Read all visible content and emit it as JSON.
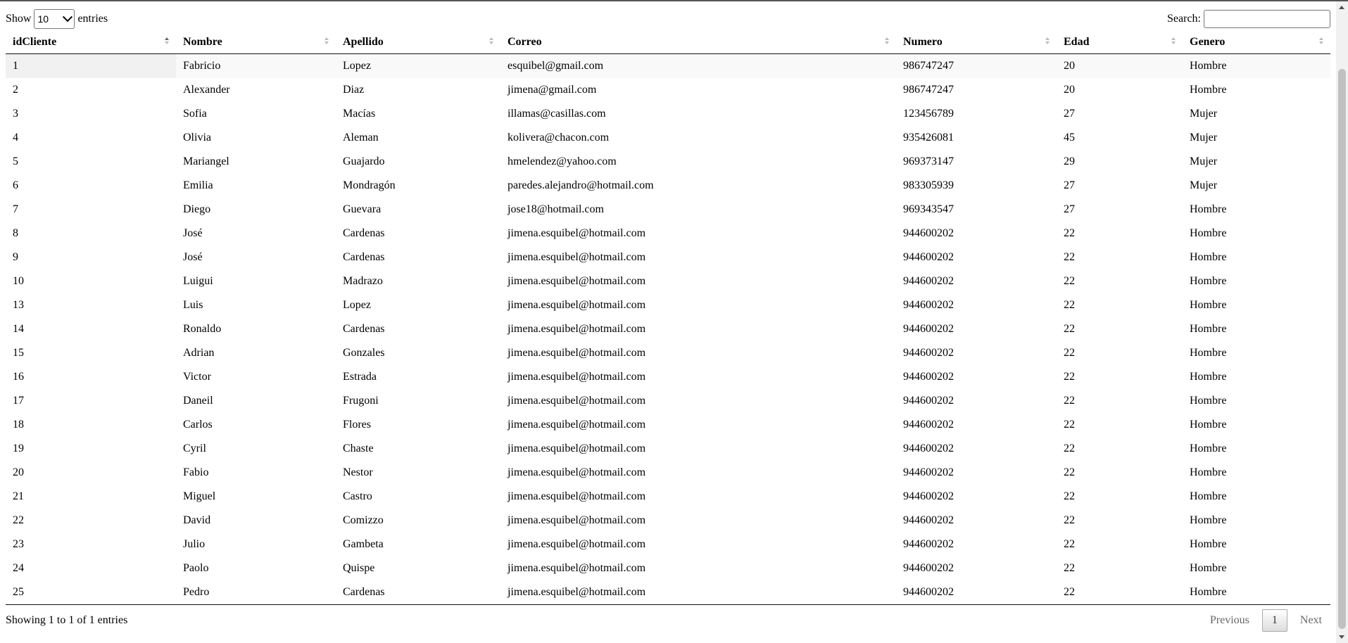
{
  "controls": {
    "show_label": "Show",
    "entries_label": "entries",
    "page_length": "10",
    "search_label": "Search:",
    "search_value": ""
  },
  "table": {
    "columns": [
      "idCliente",
      "Nombre",
      "Apellido",
      "Correo",
      "Numero",
      "Edad",
      "Genero"
    ],
    "rows": [
      [
        "1",
        "Fabricio",
        "Lopez",
        "esquibel@gmail.com",
        "986747247",
        "20",
        "Hombre"
      ],
      [
        "2",
        "Alexander",
        "Diaz",
        "jimena@gmail.com",
        "986747247",
        "20",
        "Hombre"
      ],
      [
        "3",
        "Sofia",
        "Macías",
        "illamas@casillas.com",
        "123456789",
        "27",
        "Mujer"
      ],
      [
        "4",
        "Olivia",
        "Aleman",
        "kolivera@chacon.com",
        "935426081",
        "45",
        "Mujer"
      ],
      [
        "5",
        "Mariangel",
        "Guajardo",
        "hmelendez@yahoo.com",
        "969373147",
        "29",
        "Mujer"
      ],
      [
        "6",
        "Emilia",
        "Mondragón",
        "paredes.alejandro@hotmail.com",
        "983305939",
        "27",
        "Mujer"
      ],
      [
        "7",
        "Diego",
        "Guevara",
        "jose18@hotmail.com",
        "969343547",
        "27",
        "Hombre"
      ],
      [
        "8",
        "José",
        "Cardenas",
        "jimena.esquibel@hotmail.com",
        "944600202",
        "22",
        "Hombre"
      ],
      [
        "9",
        "José",
        "Cardenas",
        "jimena.esquibel@hotmail.com",
        "944600202",
        "22",
        "Hombre"
      ],
      [
        "10",
        "Luigui",
        "Madrazo",
        "jimena.esquibel@hotmail.com",
        "944600202",
        "22",
        "Hombre"
      ],
      [
        "13",
        "Luis",
        "Lopez",
        "jimena.esquibel@hotmail.com",
        "944600202",
        "22",
        "Hombre"
      ],
      [
        "14",
        "Ronaldo",
        "Cardenas",
        "jimena.esquibel@hotmail.com",
        "944600202",
        "22",
        "Hombre"
      ],
      [
        "15",
        "Adrian",
        "Gonzales",
        "jimena.esquibel@hotmail.com",
        "944600202",
        "22",
        "Hombre"
      ],
      [
        "16",
        "Victor",
        "Estrada",
        "jimena.esquibel@hotmail.com",
        "944600202",
        "22",
        "Hombre"
      ],
      [
        "17",
        "Daneil",
        "Frugoni",
        "jimena.esquibel@hotmail.com",
        "944600202",
        "22",
        "Hombre"
      ],
      [
        "18",
        "Carlos",
        "Flores",
        "jimena.esquibel@hotmail.com",
        "944600202",
        "22",
        "Hombre"
      ],
      [
        "19",
        "Cyril",
        "Chaste",
        "jimena.esquibel@hotmail.com",
        "944600202",
        "22",
        "Hombre"
      ],
      [
        "20",
        "Fabio",
        "Nestor",
        "jimena.esquibel@hotmail.com",
        "944600202",
        "22",
        "Hombre"
      ],
      [
        "21",
        "Miguel",
        "Castro",
        "jimena.esquibel@hotmail.com",
        "944600202",
        "22",
        "Hombre"
      ],
      [
        "22",
        "David",
        "Comizzo",
        "jimena.esquibel@hotmail.com",
        "944600202",
        "22",
        "Hombre"
      ],
      [
        "23",
        "Julio",
        "Gambeta",
        "jimena.esquibel@hotmail.com",
        "944600202",
        "22",
        "Hombre"
      ],
      [
        "24",
        "Paolo",
        "Quispe",
        "jimena.esquibel@hotmail.com",
        "944600202",
        "22",
        "Hombre"
      ],
      [
        "25",
        "Pedro",
        "Cardenas",
        "jimena.esquibel@hotmail.com",
        "944600202",
        "22",
        "Hombre"
      ]
    ]
  },
  "footer": {
    "info": "Showing 1 to 1 of 1 entries",
    "previous": "Previous",
    "page": "1",
    "next": "Next"
  }
}
